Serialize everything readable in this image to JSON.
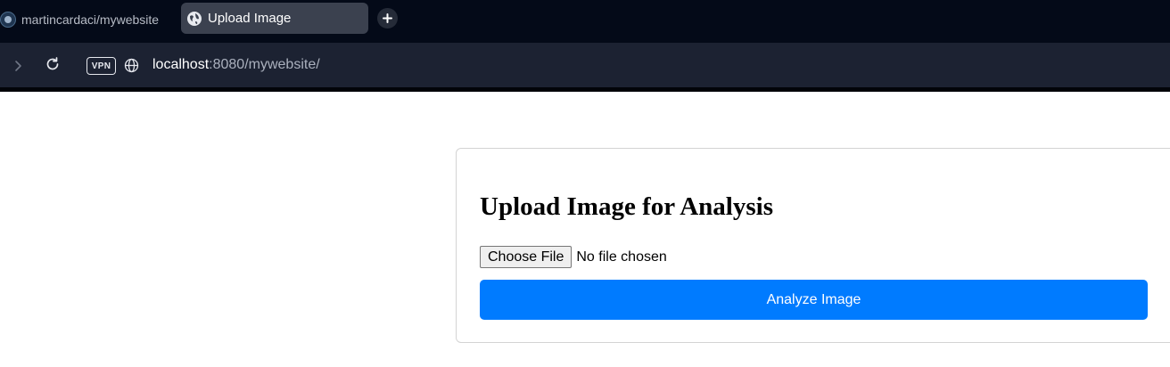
{
  "browser": {
    "tabs": [
      {
        "title": "martincardaci/mywebsite",
        "active": false
      },
      {
        "title": "Upload Image",
        "active": true
      }
    ],
    "vpn_label": "VPN",
    "url_host": "localhost",
    "url_rest": ":8080/mywebsite/",
    "colors": {
      "tabbar": "#040a18",
      "addressbar": "#1c2232",
      "active_tab": "#3b414f"
    }
  },
  "page": {
    "heading": "Upload Image for Analysis",
    "file_input": {
      "button_label": "Choose File",
      "status": "No file chosen"
    },
    "analyze_button_label": "Analyze Image",
    "colors": {
      "primary": "#007bff"
    }
  }
}
